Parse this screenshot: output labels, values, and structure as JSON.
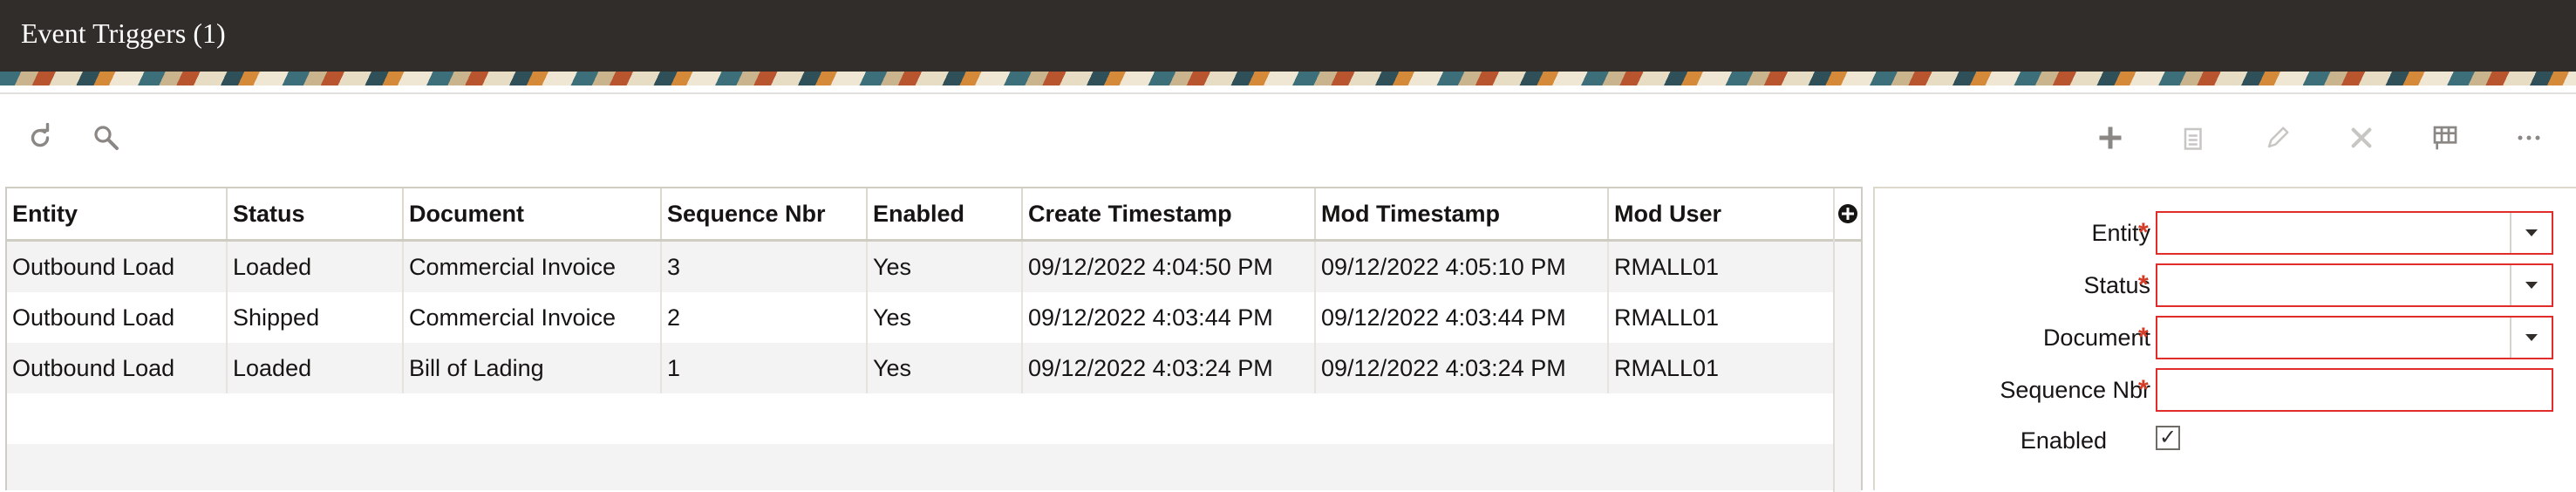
{
  "window": {
    "title": "Event Triggers (1)"
  },
  "toolbar": {
    "left": [
      {
        "name": "refresh-icon"
      },
      {
        "name": "search-icon"
      }
    ],
    "right": [
      {
        "name": "add-icon"
      },
      {
        "name": "copy-icon"
      },
      {
        "name": "edit-icon"
      },
      {
        "name": "delete-icon"
      },
      {
        "name": "grid-settings-icon"
      },
      {
        "name": "more-icon"
      }
    ]
  },
  "grid": {
    "columns": [
      "Entity",
      "Status",
      "Document",
      "Sequence Nbr",
      "Enabled",
      "Create Timestamp",
      "Mod Timestamp",
      "Mod User"
    ],
    "rows": [
      [
        "Outbound Load",
        "Loaded",
        "Commercial Invoice",
        "3",
        "Yes",
        "09/12/2022 4:04:50 PM",
        "09/12/2022 4:05:10 PM",
        "RMALL01"
      ],
      [
        "Outbound Load",
        "Shipped",
        "Commercial Invoice",
        "2",
        "Yes",
        "09/12/2022 4:03:44 PM",
        "09/12/2022 4:03:44 PM",
        "RMALL01"
      ],
      [
        "Outbound Load",
        "Loaded",
        "Bill of Lading",
        "1",
        "Yes",
        "09/12/2022 4:03:24 PM",
        "09/12/2022 4:03:24 PM",
        "RMALL01"
      ]
    ],
    "add_column_icon": "plus-circle-icon"
  },
  "form": {
    "entity_label": "Entity",
    "status_label": "Status",
    "document_label": "Document",
    "sequence_label": "Sequence Nbr",
    "enabled_label": "Enabled",
    "required_mark": "*",
    "enabled_checked": "✓"
  },
  "colors": {
    "header_bg": "#312d2a",
    "required": "#d63b25",
    "invalid_border": "#e12c2c"
  }
}
